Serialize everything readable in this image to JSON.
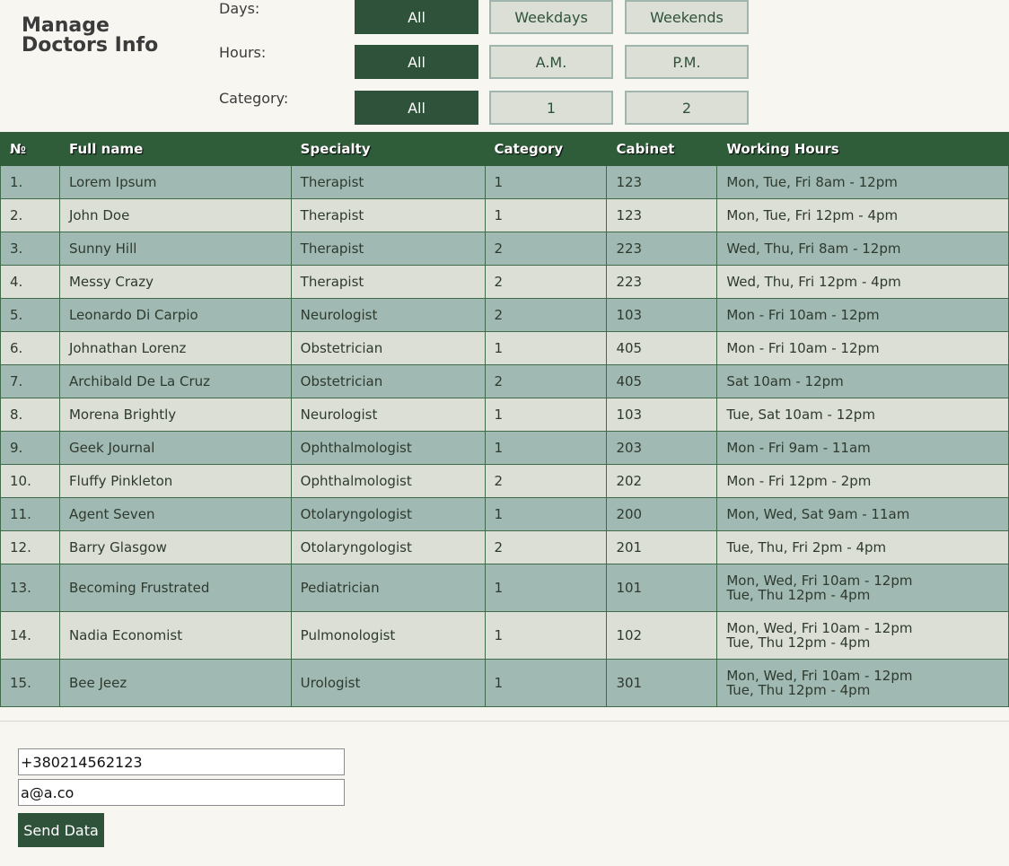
{
  "page": {
    "title": "Manage Doctors Info"
  },
  "filters": {
    "days": {
      "label": "Days:",
      "options": [
        "All",
        "Weekdays",
        "Weekends"
      ],
      "selected": "All"
    },
    "hours": {
      "label": "Hours:",
      "options": [
        "All",
        "A.M.",
        "P.M."
      ],
      "selected": "All"
    },
    "category": {
      "label": "Category:",
      "options": [
        "All",
        "1",
        "2"
      ],
      "selected": "All"
    }
  },
  "table": {
    "columns": [
      "№",
      "Full name",
      "Specialty",
      "Category",
      "Cabinet",
      "Working Hours"
    ],
    "rows": [
      {
        "num": "1.",
        "name": "Lorem Ipsum",
        "specialty": "Therapist",
        "category": "1",
        "cabinet": "123",
        "hours": [
          "Mon, Tue, Fri 8am - 12pm"
        ]
      },
      {
        "num": "2.",
        "name": "John Doe",
        "specialty": "Therapist",
        "category": "1",
        "cabinet": "123",
        "hours": [
          "Mon, Tue, Fri 12pm - 4pm"
        ]
      },
      {
        "num": "3.",
        "name": "Sunny Hill",
        "specialty": "Therapist",
        "category": "2",
        "cabinet": "223",
        "hours": [
          "Wed, Thu, Fri 8am - 12pm"
        ]
      },
      {
        "num": "4.",
        "name": "Messy Crazy",
        "specialty": "Therapist",
        "category": "2",
        "cabinet": "223",
        "hours": [
          "Wed, Thu, Fri 12pm - 4pm"
        ]
      },
      {
        "num": "5.",
        "name": "Leonardo Di Carpio",
        "specialty": "Neurologist",
        "category": "2",
        "cabinet": "103",
        "hours": [
          "Mon - Fri 10am - 12pm"
        ]
      },
      {
        "num": "6.",
        "name": "Johnathan Lorenz",
        "specialty": "Obstetrician",
        "category": "1",
        "cabinet": "405",
        "hours": [
          "Mon - Fri 10am - 12pm"
        ]
      },
      {
        "num": "7.",
        "name": "Archibald De La Cruz",
        "specialty": "Obstetrician",
        "category": "2",
        "cabinet": "405",
        "hours": [
          "Sat 10am - 12pm"
        ]
      },
      {
        "num": "8.",
        "name": "Morena Brightly",
        "specialty": "Neurologist",
        "category": "1",
        "cabinet": "103",
        "hours": [
          "Tue, Sat 10am - 12pm"
        ]
      },
      {
        "num": "9.",
        "name": "Geek Journal",
        "specialty": "Ophthalmologist",
        "category": "1",
        "cabinet": "203",
        "hours": [
          "Mon - Fri 9am - 11am"
        ]
      },
      {
        "num": "10.",
        "name": "Fluffy Pinkleton",
        "specialty": "Ophthalmologist",
        "category": "2",
        "cabinet": "202",
        "hours": [
          "Mon - Fri 12pm - 2pm"
        ]
      },
      {
        "num": "11.",
        "name": "Agent Seven",
        "specialty": "Otolaryngologist",
        "category": "1",
        "cabinet": "200",
        "hours": [
          "Mon, Wed, Sat 9am - 11am"
        ]
      },
      {
        "num": "12.",
        "name": "Barry Glasgow",
        "specialty": "Otolaryngologist",
        "category": "2",
        "cabinet": "201",
        "hours": [
          "Tue, Thu, Fri 2pm - 4pm"
        ]
      },
      {
        "num": "13.",
        "name": "Becoming Frustrated",
        "specialty": "Pediatrician",
        "category": "1",
        "cabinet": "101",
        "hours": [
          "Mon, Wed, Fri 10am - 12pm",
          "Tue, Thu 12pm - 4pm"
        ]
      },
      {
        "num": "14.",
        "name": "Nadia Economist",
        "specialty": "Pulmonologist",
        "category": "1",
        "cabinet": "102",
        "hours": [
          "Mon, Wed, Fri 10am - 12pm",
          "Tue, Thu 12pm - 4pm"
        ]
      },
      {
        "num": "15.",
        "name": "Bee Jeez",
        "specialty": "Urologist",
        "category": "1",
        "cabinet": "301",
        "hours": [
          "Mon, Wed, Fri 10am - 12pm",
          "Tue, Thu 12pm - 4pm"
        ]
      }
    ]
  },
  "form": {
    "phone_value": "+380214562123",
    "email_value": "a@a.co",
    "submit_label": "Send Data"
  },
  "colors": {
    "accent": "#2f523a",
    "header_bg": "#2f5d3a",
    "row_odd": "#a0b9b2",
    "row_even": "#dbdfd6",
    "background": "#f7f6f1"
  }
}
